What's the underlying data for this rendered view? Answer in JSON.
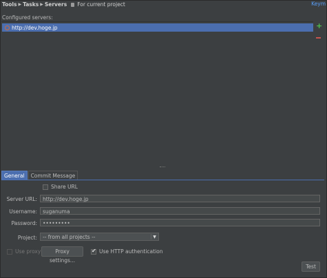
{
  "breadcrumb": {
    "items": [
      "Tools",
      "Tasks",
      "Servers"
    ],
    "project_scope": "For current project"
  },
  "keymap_link": "Keym",
  "servers": {
    "label": "Configured servers:",
    "items": [
      {
        "url": "http://dev.hoge.jp",
        "icon": "redmine-server-icon"
      }
    ],
    "add_icon": "plus-icon",
    "remove_icon": "minus-icon"
  },
  "tabs": [
    {
      "label": "General",
      "active": true
    },
    {
      "label": "Commit Message",
      "active": false
    }
  ],
  "general": {
    "share_url_label": "Share URL",
    "share_url_checked": false,
    "server_url_label": "Server URL:",
    "server_url_value": "http://dev.hoge.jp",
    "username_label": "Username:",
    "username_value": "suganuma",
    "password_label": "Password:",
    "password_value": "•••••••••",
    "project_label": "Project:",
    "project_value": "-- from all projects --",
    "use_proxy_label": "Use proxy",
    "use_proxy_checked": false,
    "proxy_settings_label": "Proxy settings...",
    "use_http_auth_label": "Use HTTP authentication",
    "use_http_auth_checked": true,
    "test_button_label": "Test"
  },
  "colors": {
    "background": "#3c3f41",
    "selection": "#4b6eaf",
    "add_green": "#4fbf4f",
    "remove_red": "#c75450",
    "link_blue": "#589df6"
  }
}
